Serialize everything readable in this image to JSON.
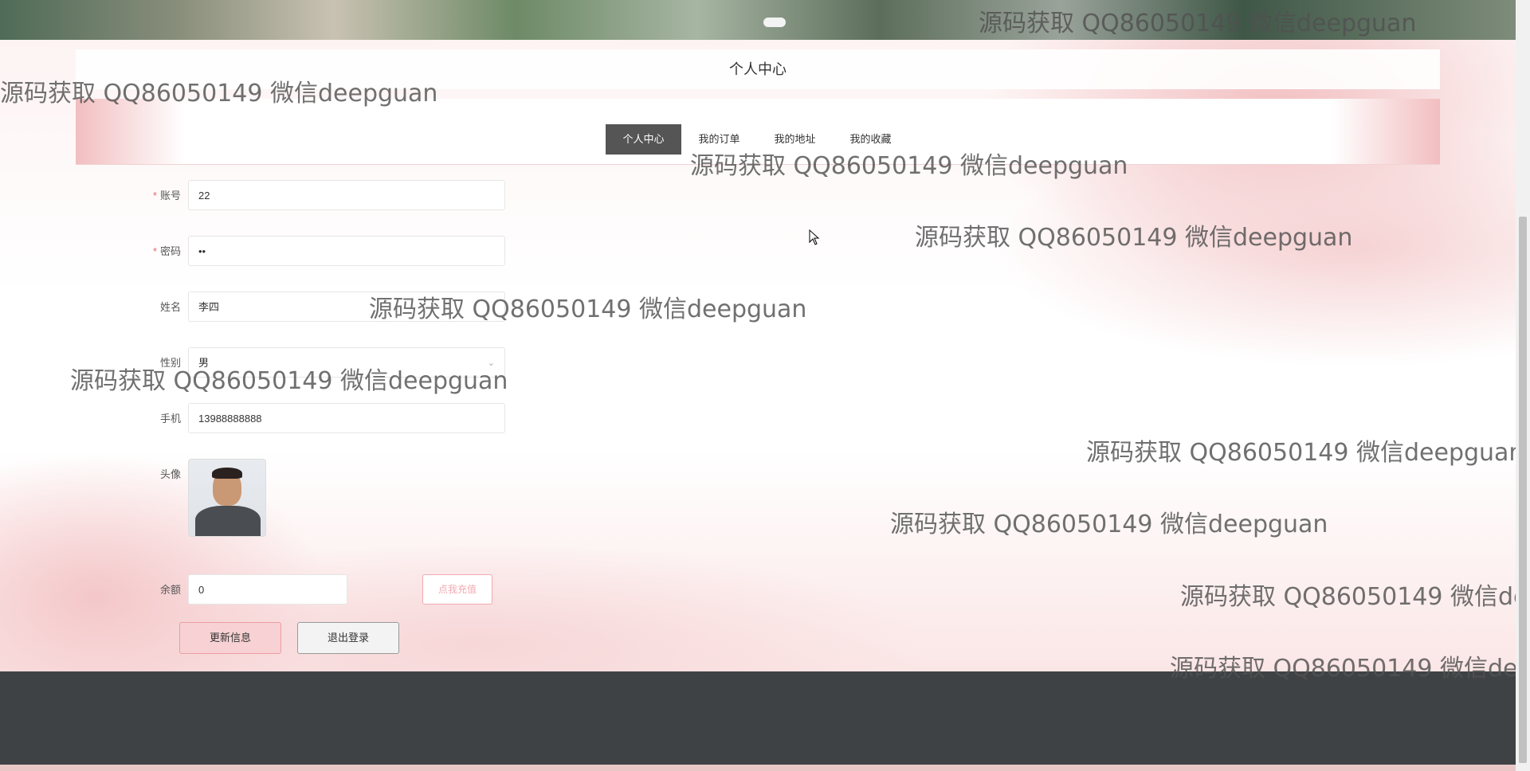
{
  "page_title": "个人中心",
  "tabs": [
    {
      "label": "个人中心",
      "active": true
    },
    {
      "label": "我的订单",
      "active": false
    },
    {
      "label": "我的地址",
      "active": false
    },
    {
      "label": "我的收藏",
      "active": false
    }
  ],
  "form": {
    "account": {
      "label": "账号",
      "required": true,
      "value": "22"
    },
    "password": {
      "label": "密码",
      "required": true,
      "value": "••"
    },
    "name": {
      "label": "姓名",
      "required": false,
      "value": "李四"
    },
    "gender": {
      "label": "性别",
      "required": false,
      "value": "男"
    },
    "phone": {
      "label": "手机",
      "required": false,
      "value": "13988888888"
    },
    "avatar": {
      "label": "头像"
    },
    "balance": {
      "label": "余额",
      "value": "0",
      "recharge_label": "点我充值"
    }
  },
  "buttons": {
    "update": "更新信息",
    "logout": "退出登录"
  },
  "watermark": "源码获取 QQ86050149 微信deepguan",
  "colors": {
    "accent_pink": "#f1a9b0",
    "tab_active": "#555555",
    "footer": "#3f4245"
  }
}
